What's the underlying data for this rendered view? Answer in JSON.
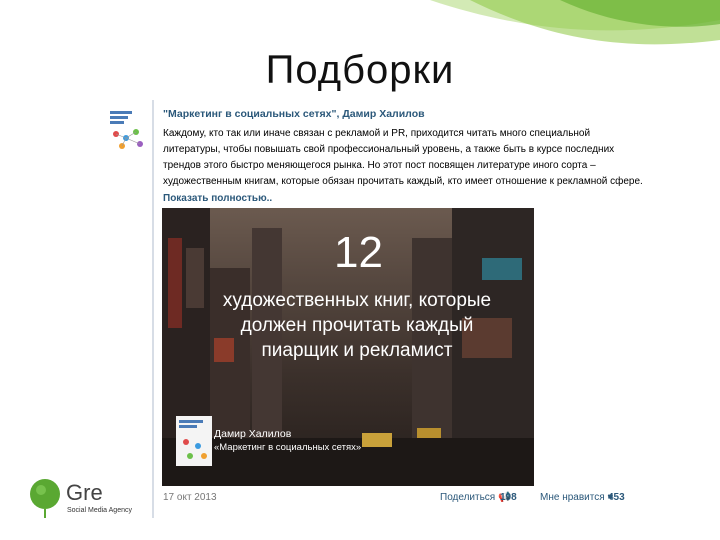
{
  "slide": {
    "title": "Подборки"
  },
  "post": {
    "title": "\"Маркетинг в социальных сетях\", Дамир Халилов",
    "text_lines": [
      "Каждому, кто так или иначе связан с рекламой и PR, приходится читать много специальной",
      "литературы, чтобы повышать свой профессиональный уровень, а также быть в курсе последних",
      "трендов этого быстро меняющегося рынка. Но этот пост посвящен литературе иного сорта –",
      "художественным книгам, которые обязан прочитать каждый, кто имеет отношение к рекламной сфере."
    ],
    "show_more": "Показать полностью..",
    "date": "17 окт 2013",
    "share_label": "Поделиться",
    "share_count": "198",
    "like_label": "Мне нравится",
    "like_count": "453"
  },
  "image": {
    "number": "12",
    "title_lines": [
      "художественных книг, которые",
      "должен прочитать каждый",
      "пиарщик и рекламист"
    ],
    "author": "Дамир Халилов",
    "book": "«Маркетинг в социальных сетях»"
  },
  "logo": {
    "name": "Gre",
    "subtitle": "Social Media Agency",
    "color": "#5aa832"
  },
  "colors": {
    "accent_green": "#7cc242",
    "link": "#2b587a"
  }
}
